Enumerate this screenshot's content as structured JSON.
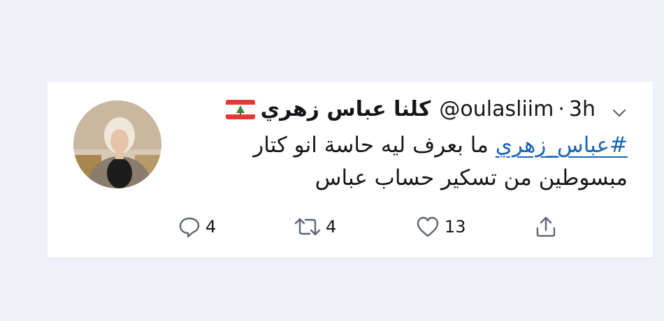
{
  "tweet": {
    "display_name": "كلنا عباس زهري",
    "handle": "@oulasliim",
    "separator": "·",
    "time": "3h",
    "flag_icon": "lebanon-flag-icon",
    "text_line_1_hashtag": "#عباس_زهري",
    "text_line_1_rest": " ما بعرف ليه حاسة انو كتار",
    "text_line_2": "مبسوطين من تسكير حساب عباس",
    "link_color": "#1b63b8"
  },
  "actions": {
    "reply_count": "4",
    "retweet_count": "4",
    "like_count": "13",
    "icons": [
      "reply-icon",
      "retweet-icon",
      "like-icon",
      "share-icon"
    ]
  },
  "colors": {
    "background": "#eef1f8",
    "card": "#ffffff",
    "text": "#14171a",
    "icon": "#5b6670"
  }
}
